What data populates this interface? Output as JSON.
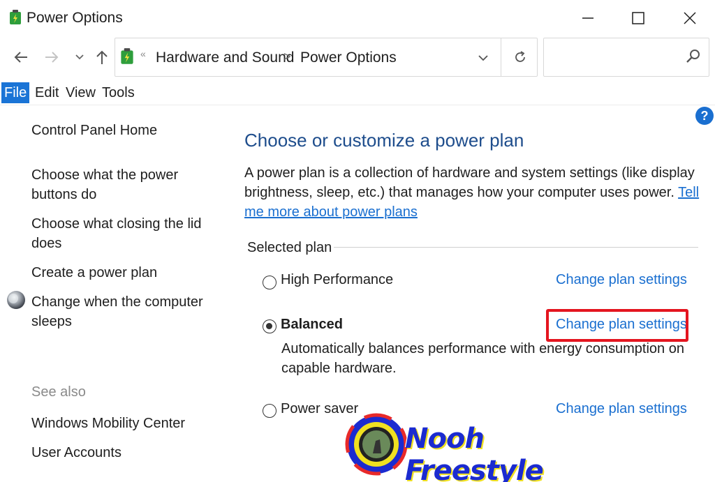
{
  "window": {
    "title": "Power Options",
    "controls": {
      "minimize": "minimize",
      "maximize": "maximize",
      "close": "close"
    }
  },
  "address": {
    "breadcrumbs": [
      "Hardware and Sound",
      "Power Options"
    ],
    "separator": ">",
    "search_placeholder": ""
  },
  "menu": {
    "items": [
      "File",
      "Edit",
      "View",
      "Tools"
    ],
    "active": "File"
  },
  "sidebar": {
    "home": "Control Panel Home",
    "links": [
      "Choose what the power buttons do",
      "Choose what closing the lid does",
      "Create a power plan",
      "Change when the computer sleeps"
    ],
    "see_also_label": "See also",
    "see_also_links": [
      "Windows Mobility Center",
      "User Accounts"
    ]
  },
  "main": {
    "heading": "Choose or customize a power plan",
    "description": "A power plan is a collection of hardware and system settings (like display brightness, sleep, etc.) that manages how your computer uses power.",
    "description_link": "Tell me more about power plans",
    "section_label": "Selected plan",
    "plans": [
      {
        "name": "High Performance",
        "selected": false,
        "action": "Change plan settings",
        "description": ""
      },
      {
        "name": "Balanced",
        "selected": true,
        "action": "Change plan settings",
        "description": "Automatically balances performance with energy consumption on capable hardware."
      },
      {
        "name": "Power saver",
        "selected": false,
        "action": "Change plan settings",
        "description": ""
      }
    ],
    "help_glyph": "?"
  },
  "watermark": {
    "text": "Nooh Freestyle"
  },
  "colors": {
    "link": "#1a6fd0",
    "heading": "#1e4d8c",
    "menu_active_bg": "#1a74d6",
    "highlight": "#e4151f",
    "muted": "#8a8a8a"
  },
  "icons": {
    "app": "power-options-icon",
    "back": "back-arrow-icon",
    "forward": "forward-arrow-icon",
    "recent": "chevron-down-icon",
    "up": "up-arrow-icon",
    "refresh": "refresh-icon",
    "search": "search-icon",
    "help": "help-icon",
    "sleep": "shield-icon"
  }
}
